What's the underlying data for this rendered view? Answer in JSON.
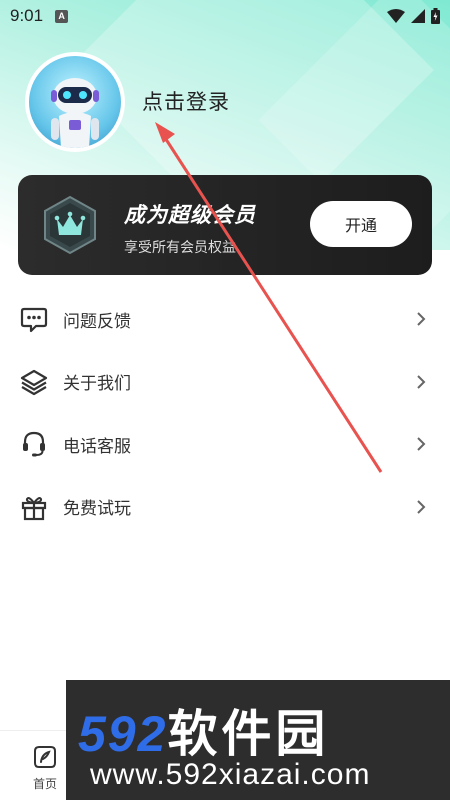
{
  "status_bar": {
    "time": "9:01",
    "notification_letter": "A",
    "icons": [
      "wifi-icon",
      "signal-icon",
      "battery-icon"
    ]
  },
  "profile": {
    "login_text": "点击登录",
    "avatar": "robot-avatar"
  },
  "vip": {
    "title": "成为超级会员",
    "subtitle": "享受所有会员权益",
    "button": "开通"
  },
  "menu": [
    {
      "label": "问题反馈",
      "icon": "feedback-icon"
    },
    {
      "label": "关于我们",
      "icon": "layers-icon"
    },
    {
      "label": "电话客服",
      "icon": "headset-icon"
    },
    {
      "label": "免费试玩",
      "icon": "gift-icon"
    }
  ],
  "bottom_nav": {
    "home_label": "首页"
  },
  "watermark": {
    "number": "592",
    "brand": "软件园",
    "url": "www.592xiazai.com"
  },
  "colors": {
    "header_gradient": "#7fe9d2",
    "vip_card": "#232323",
    "annotation_arrow": "#e8534f",
    "watermark_blue": "#2f6de8"
  }
}
